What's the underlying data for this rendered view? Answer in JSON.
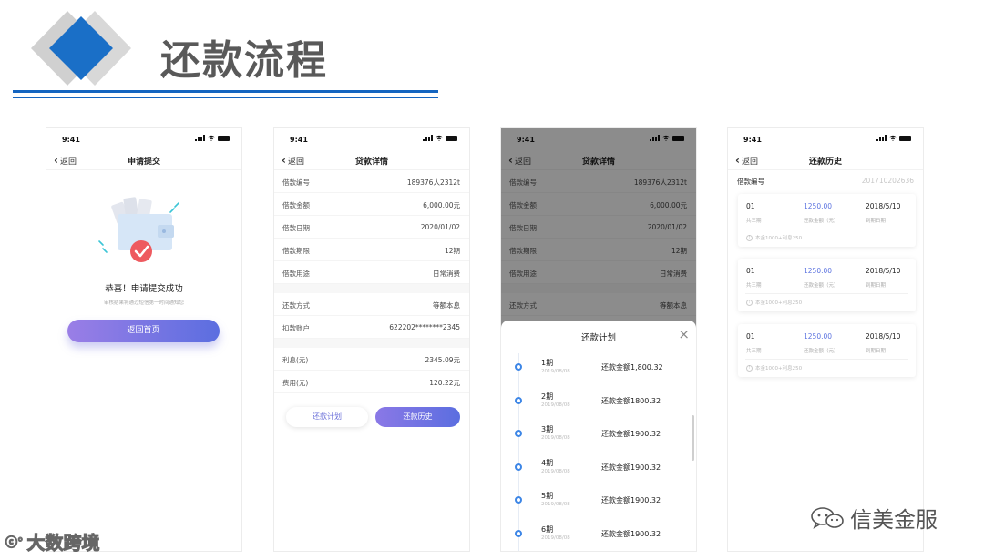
{
  "slide": {
    "title": "还款流程"
  },
  "colors": {
    "accent_blue": "#1565c0",
    "button_gradient_start": "#9a7ee6",
    "button_gradient_end": "#5b6ee0",
    "amount_blue": "#5d74e0"
  },
  "status": {
    "time": "9:41"
  },
  "nav": {
    "back_label": "返回"
  },
  "screen1": {
    "title": "申请提交",
    "success_text": "恭喜！申请提交成功",
    "sub_text": "审核结果将通过短信第一时间通知您",
    "home_button": "返回首页"
  },
  "screen2": {
    "title": "贷款详情",
    "group1": [
      {
        "k": "借款编号",
        "v": "189376人2312t"
      },
      {
        "k": "借款金额",
        "v": "6,000.00元"
      },
      {
        "k": "借款日期",
        "v": "2020/01/02"
      },
      {
        "k": "借款期限",
        "v": "12期"
      },
      {
        "k": "借款用途",
        "v": "日常消费"
      }
    ],
    "group2": [
      {
        "k": "还款方式",
        "v": "等额本息"
      },
      {
        "k": "扣款账户",
        "v": "622202********2345"
      }
    ],
    "group3": [
      {
        "k": "利息(元)",
        "v": "2345.09元"
      },
      {
        "k": "费用(元)",
        "v": "120.22元"
      }
    ],
    "plan_button": "还款计划",
    "history_button": "还款历史"
  },
  "screen3": {
    "title": "贷款详情",
    "rows": [
      {
        "k": "借款编号",
        "v": "189376人2312t"
      },
      {
        "k": "借款金额",
        "v": "6,000.00元"
      },
      {
        "k": "借款日期",
        "v": "2020/01/02"
      },
      {
        "k": "借款期限",
        "v": "12期"
      },
      {
        "k": "借款用途",
        "v": "日常消费"
      },
      {
        "k": "还款方式",
        "v": "等额本息"
      }
    ],
    "sheet_title": "还款计划",
    "plan": [
      {
        "period": "1期",
        "date": "2019/08/08",
        "amount": "还款金额1,800.32"
      },
      {
        "period": "2期",
        "date": "2019/08/08",
        "amount": "还款金额1800.32"
      },
      {
        "period": "3期",
        "date": "2019/08/08",
        "amount": "还款金额1900.32"
      },
      {
        "period": "4期",
        "date": "2019/08/08",
        "amount": "还款金额1900.32"
      },
      {
        "period": "5期",
        "date": "2019/08/08",
        "amount": "还款金额1900.32"
      },
      {
        "period": "6期",
        "date": "2019/08/08",
        "amount": "还款金额1900.32"
      }
    ]
  },
  "screen4": {
    "title": "还款历史",
    "loan_no_label": "借款编号",
    "loan_no_value": "201710202636",
    "records": [
      {
        "period": "01",
        "period_sub": "共三期",
        "amount": "1250.00",
        "amount_sub": "还款金额（元）",
        "date": "2018/5/10",
        "date_sub": "到期日期",
        "detail": "本金1000+利息250"
      },
      {
        "period": "01",
        "period_sub": "共三期",
        "amount": "1250.00",
        "amount_sub": "还款金额（元）",
        "date": "2018/5/10",
        "date_sub": "到期日期",
        "detail": "本金1000+利息250"
      },
      {
        "period": "01",
        "period_sub": "共三期",
        "amount": "1250.00",
        "amount_sub": "还款金额（元）",
        "date": "2018/5/10",
        "date_sub": "到期日期",
        "detail": "本金1000+利息250"
      }
    ]
  },
  "watermarks": {
    "left": "大数跨境",
    "right": "信美金服"
  }
}
